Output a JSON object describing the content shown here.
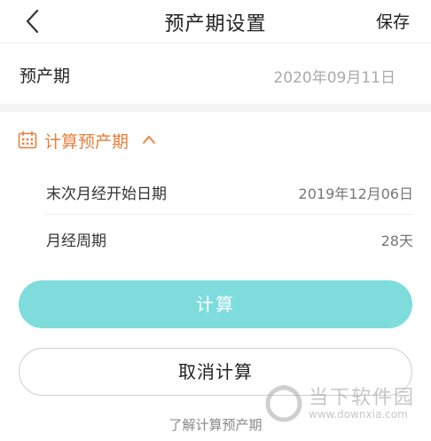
{
  "header": {
    "title": "预产期设置",
    "save_label": "保存",
    "back_icon": "chevron-left-icon"
  },
  "due_date": {
    "label": "预产期",
    "value": "2020年09月11日"
  },
  "calculator": {
    "title": "计算预产期",
    "icon": "calendar-icon",
    "toggle_icon": "chevron-up-icon",
    "accent_color": "#e87e3b",
    "rows": [
      {
        "label": "末次月经开始日期",
        "value": "2019年12月06日"
      },
      {
        "label": "月经周期",
        "value": "28天"
      }
    ],
    "calculate_label": "计算",
    "calculate_color": "#7fdcdc",
    "cancel_label": "取消计算",
    "learn_more_label": "了解计算预产期"
  },
  "watermark": {
    "name": "当下软件园",
    "url": "www.downxia.com"
  }
}
